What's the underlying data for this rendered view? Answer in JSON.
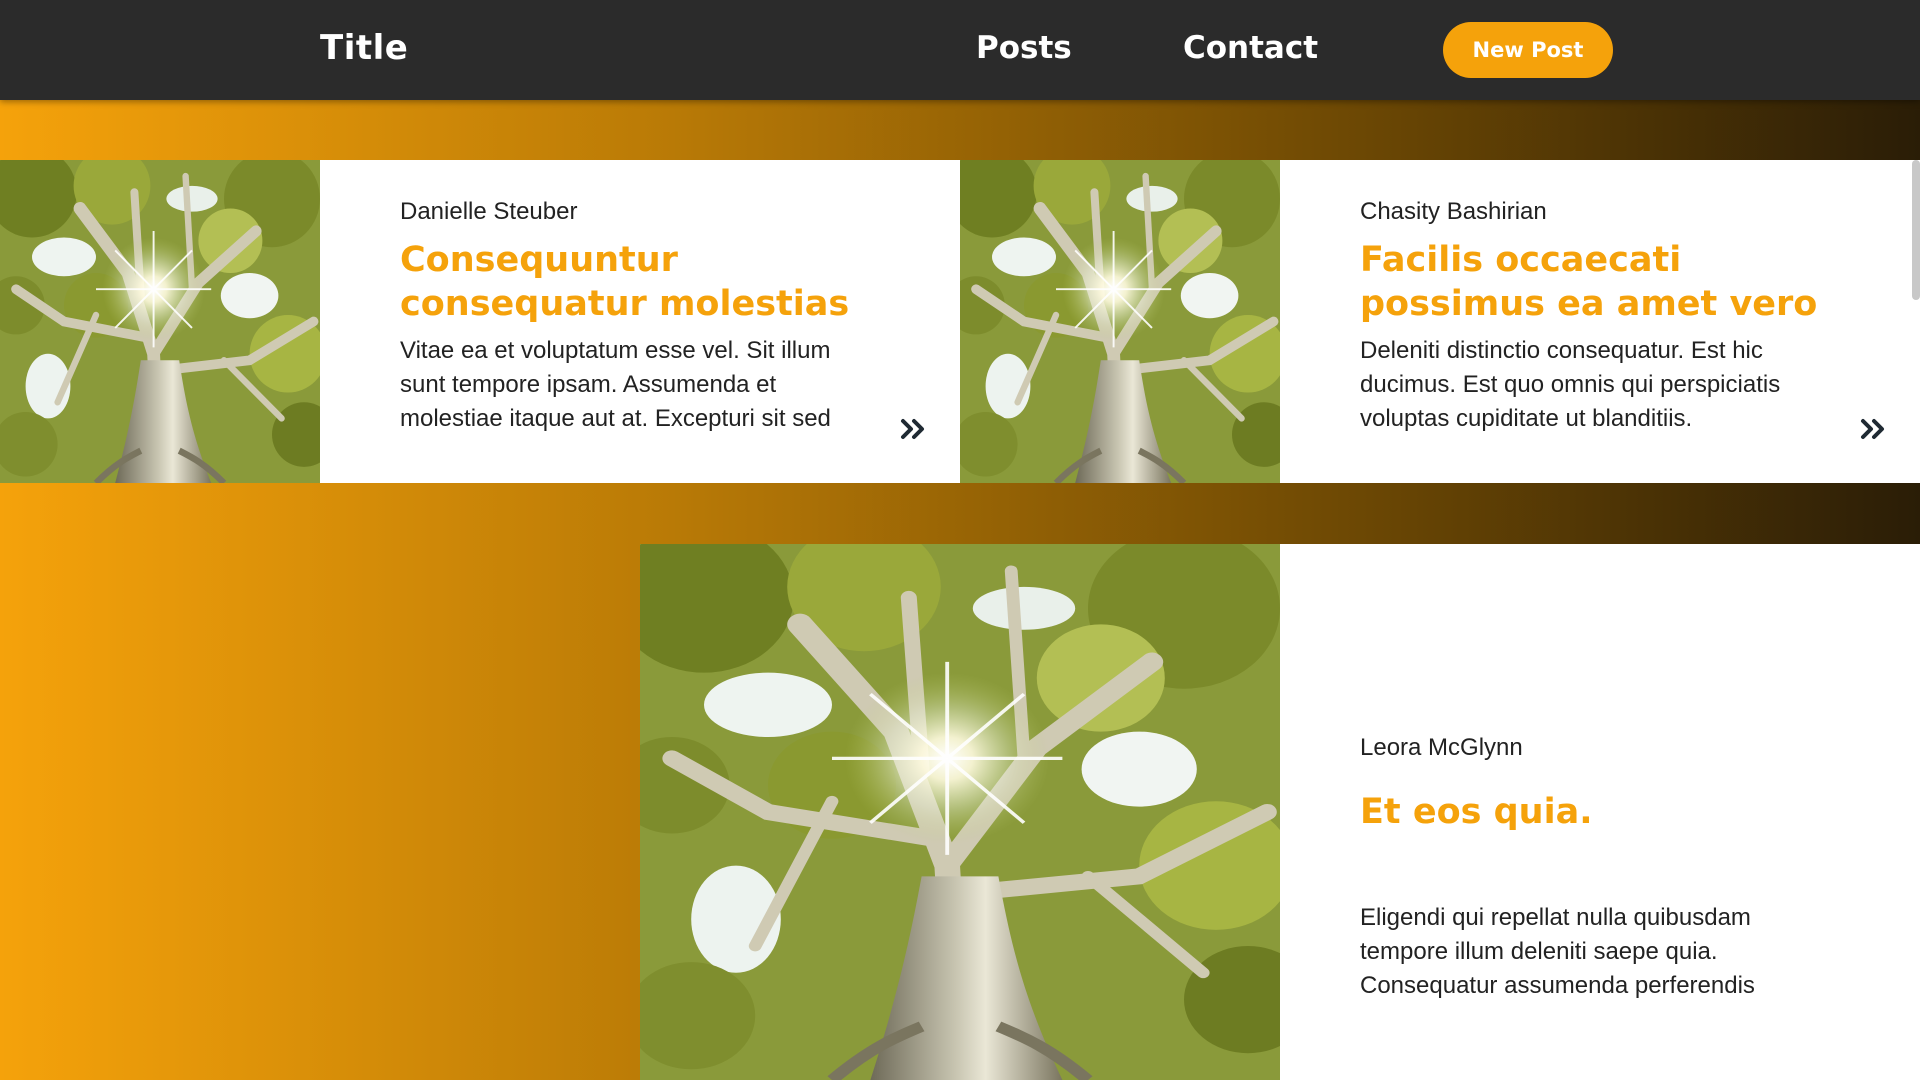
{
  "header": {
    "title": "Title",
    "nav": [
      "Posts",
      "Contact"
    ],
    "new_post_label": "New Post"
  },
  "posts": [
    {
      "author": "Danielle Steuber",
      "title": "Consequuntur consequatur molestias",
      "excerpt": "Vitae ea et voluptatum esse vel. Sit illum sunt tempore ipsam. Assumenda et molestiae itaque aut at. Excepturi sit sed",
      "image": "tree-photo",
      "more_icon": "double-chevron-right-icon"
    },
    {
      "author": "Chasity Bashirian",
      "title": "Facilis occaecati possimus ea amet vero",
      "excerpt": "Deleniti distinctio consequatur. Est hic ducimus. Est quo omnis qui perspiciatis voluptas cupiditate ut blanditiis.",
      "image": "tree-photo",
      "more_icon": "double-chevron-right-icon"
    },
    {
      "author": "Leora McGlynn",
      "title": "Et eos quia.",
      "excerpt": "Eligendi qui repellat nulla quibusdam tempore illum deleniti saepe quia. Consequatur assumenda perferendis",
      "image": "tree-photo"
    }
  ],
  "colors": {
    "accent": "#f5a20b",
    "header_bg": "#2b2b2b",
    "gradient_dark": "#2a1d06"
  }
}
